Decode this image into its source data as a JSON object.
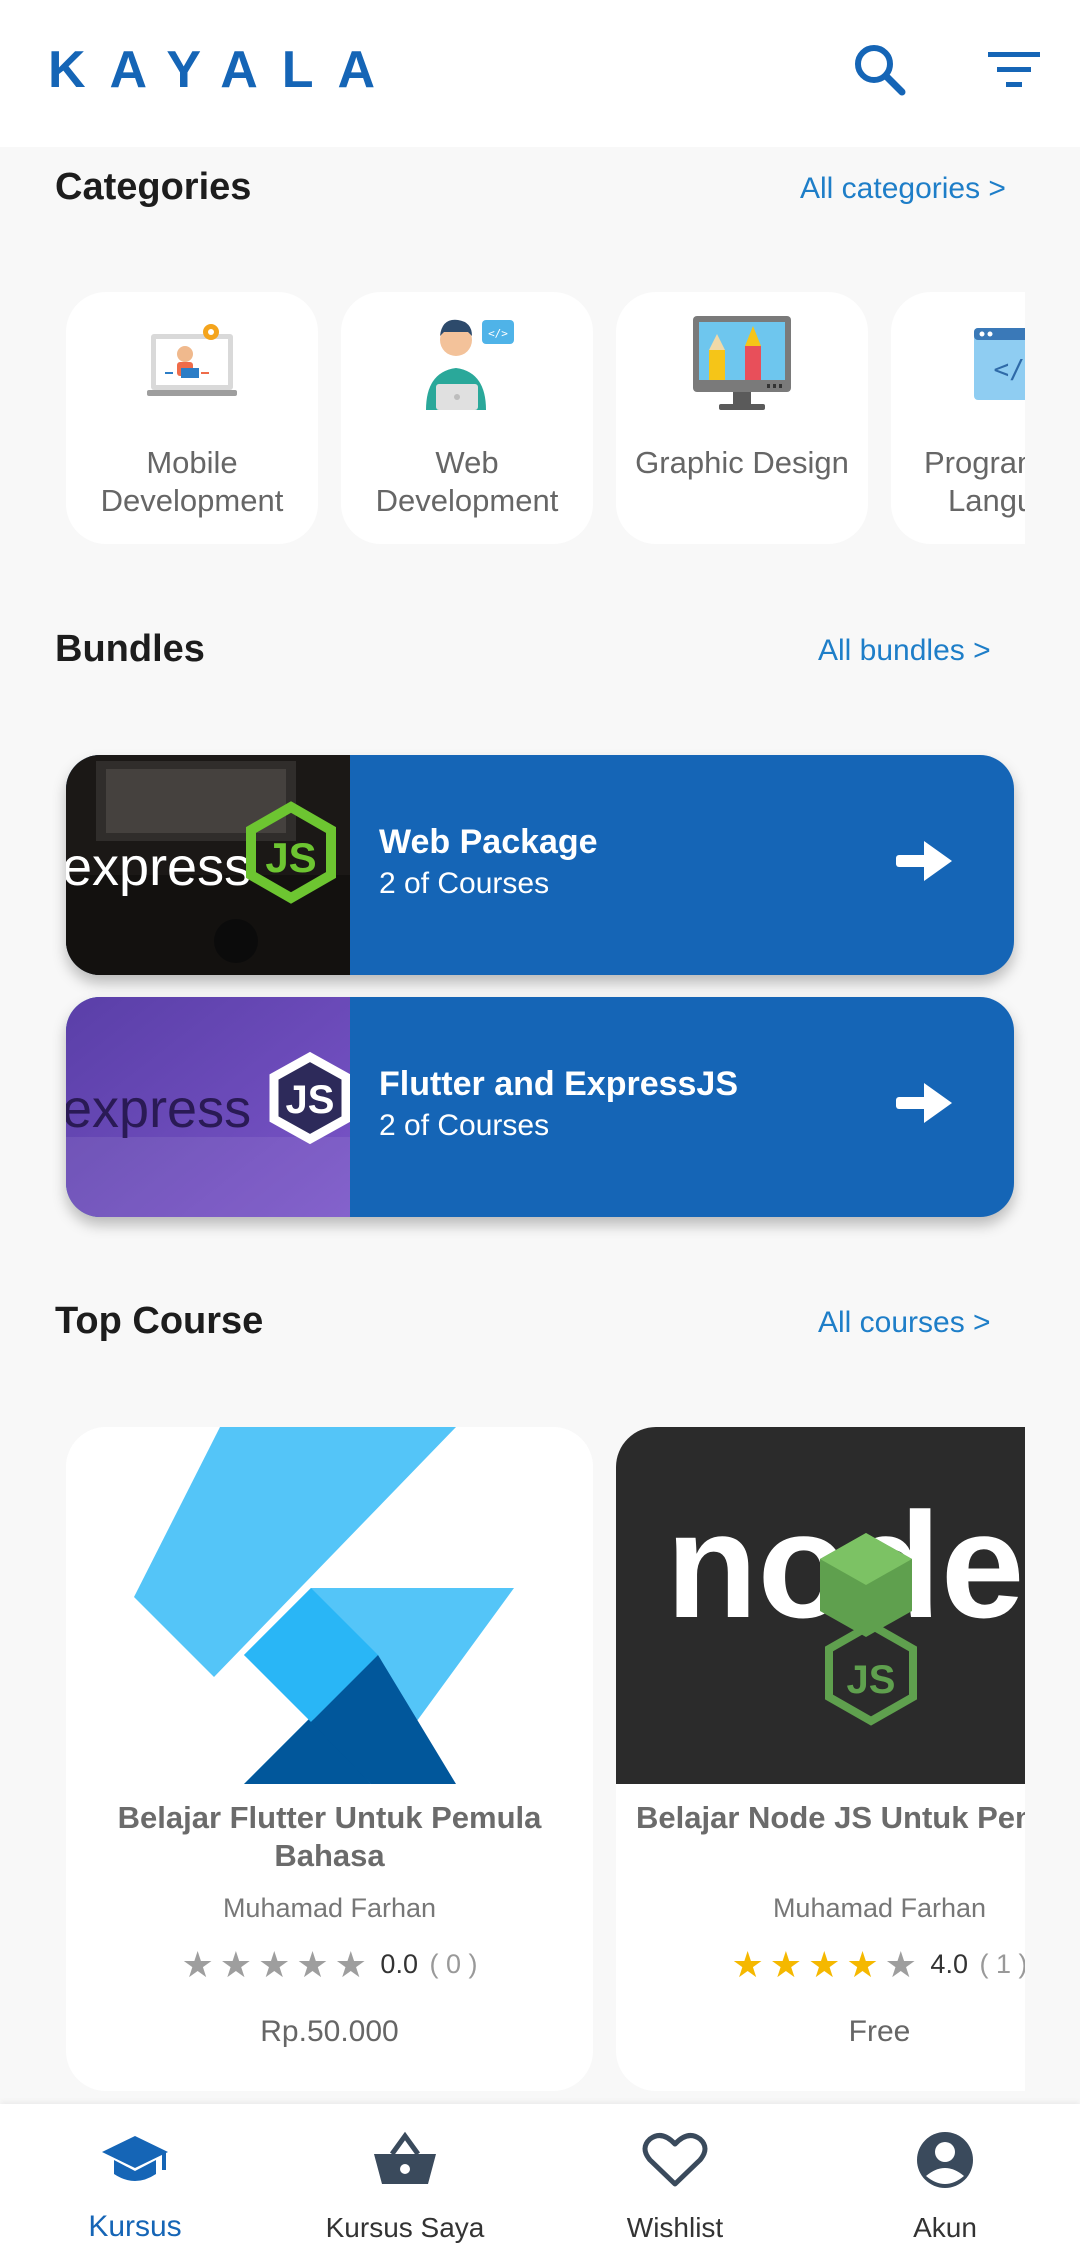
{
  "header": {
    "logo": "KAYALA",
    "icons": [
      "search-icon",
      "filter-icon"
    ]
  },
  "categories": {
    "title": "Categories",
    "link": "All categories >",
    "items": [
      {
        "label": "Mobile Development",
        "icon": "mobile-development-icon"
      },
      {
        "label": "Web Development",
        "icon": "web-development-icon"
      },
      {
        "label": "Graphic Design",
        "icon": "graphic-design-icon"
      },
      {
        "label": "Programming Language",
        "icon": "programming-language-icon"
      }
    ]
  },
  "bundles": {
    "title": "Bundles",
    "link": "All bundles >",
    "items": [
      {
        "title": "Web Package",
        "subtitle": "2 of Courses",
        "image_text": "express",
        "image_badge": "JS"
      },
      {
        "title": "Flutter and ExpressJS",
        "subtitle": "2 of Courses",
        "image_text": "express",
        "image_badge": "JS"
      }
    ]
  },
  "top_course": {
    "title": "Top Course",
    "link": "All courses >",
    "items": [
      {
        "title": "Belajar Flutter Untuk Pemula Bahasa",
        "author": "Muhamad Farhan",
        "rating": "0.0",
        "reviews": "( 0 )",
        "stars_filled": 0,
        "price": "Rp.50.000",
        "image": "flutter-logo"
      },
      {
        "title": "Belajar Node JS Untuk Pemula Bahasa",
        "author": "Muhamad Farhan",
        "rating": "4.0",
        "reviews": "( 1 )",
        "stars_filled": 4,
        "price": "Free",
        "image": "nodejs-logo",
        "image_text": "node",
        "image_badge": "JS"
      }
    ]
  },
  "bottom_nav": {
    "active": "Kursus",
    "items": [
      {
        "label": "Kursus",
        "icon": "graduation-cap-icon"
      },
      {
        "label": "Kursus Saya",
        "icon": "basket-icon"
      },
      {
        "label": "Wishlist",
        "icon": "heart-icon"
      },
      {
        "label": "Akun",
        "icon": "account-circle-icon"
      }
    ]
  },
  "colors": {
    "primary": "#1565b6",
    "link": "#1e7ec8",
    "star_filled": "#f5b800",
    "star_empty": "#9e9e9e"
  }
}
